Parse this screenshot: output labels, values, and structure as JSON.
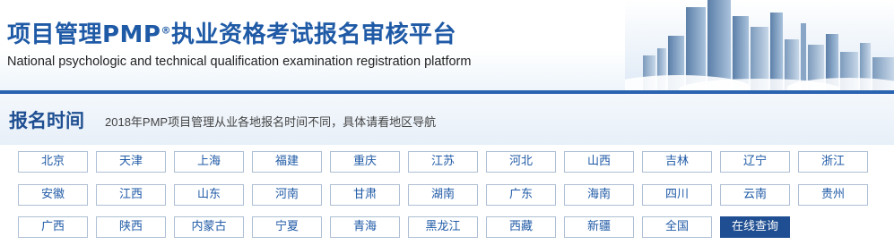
{
  "banner": {
    "title_main": "项目管理PMP",
    "title_reg": "®",
    "title_rest": "执业资格考试报名审核平台",
    "subtitle": "National psychologic and technical qualification examination registration platform"
  },
  "section": {
    "title": "报名时间",
    "note": "2018年PMP项目管理从业各地报名时间不同，具体请看地区导航"
  },
  "regions": [
    "北京",
    "天津",
    "上海",
    "福建",
    "重庆",
    "江苏",
    "河北",
    "山西",
    "吉林",
    "辽宁",
    "浙江",
    "安徽",
    "江西",
    "山东",
    "河南",
    "甘肃",
    "湖南",
    "广东",
    "海南",
    "四川",
    "云南",
    "贵州",
    "广西",
    "陕西",
    "内蒙古",
    "宁夏",
    "青海",
    "黑龙江",
    "西藏",
    "新疆",
    "全国",
    "在线查询"
  ],
  "active_region": "在线查询",
  "colors": {
    "brand_blue": "#1f5aa6",
    "active_bg": "#1f4f92",
    "divider": "#2a63b0"
  }
}
